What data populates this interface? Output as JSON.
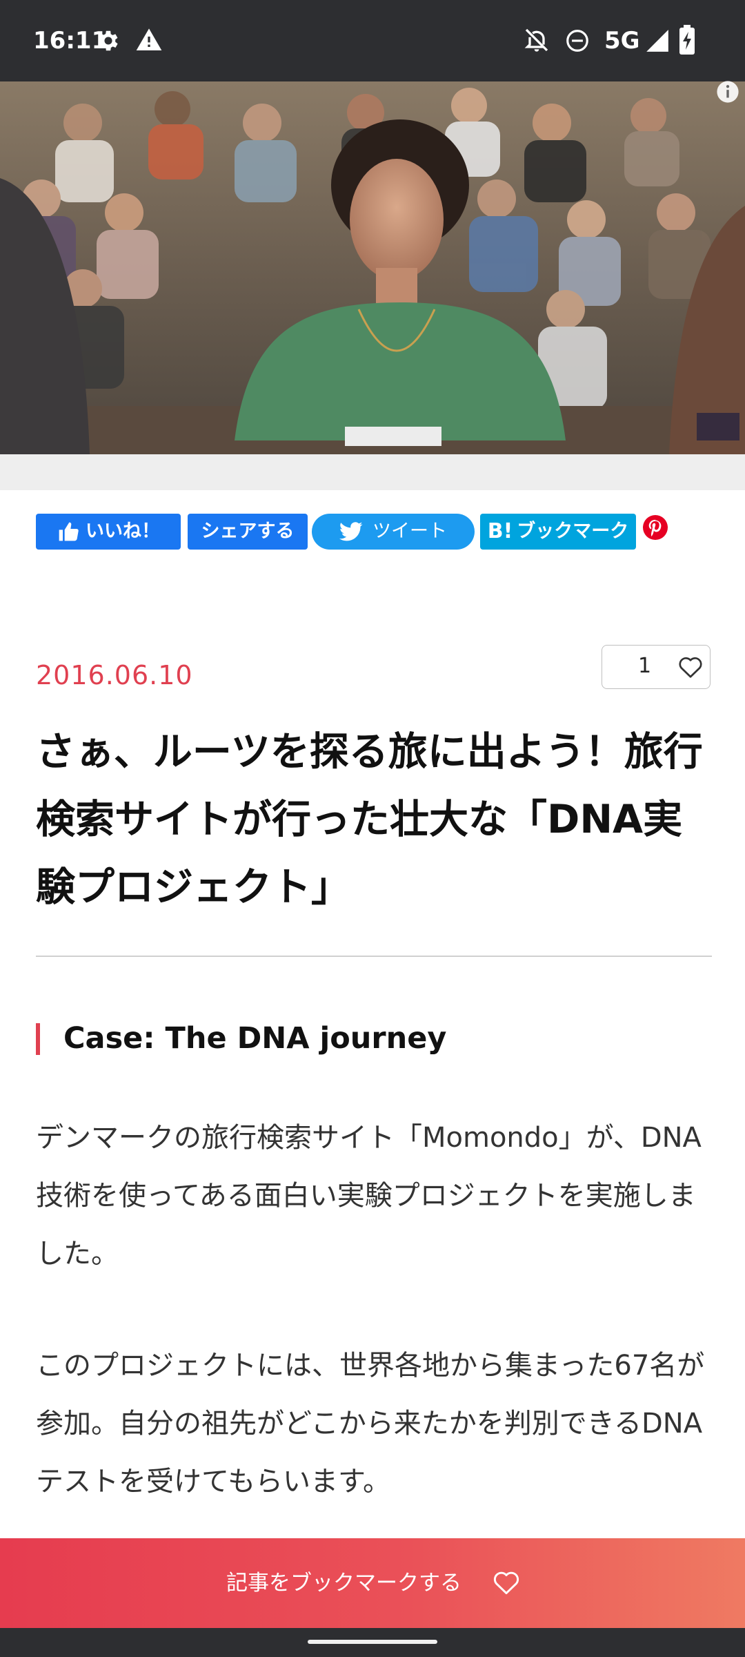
{
  "status_bar": {
    "time": "16:11",
    "network": "5G",
    "icons": [
      "gear-icon",
      "warning-icon",
      "bell-off-icon",
      "do-not-disturb-icon",
      "signal-icon",
      "battery-charging-icon"
    ]
  },
  "hero": {
    "image_alt": "woman in green shirt seated in front of audience",
    "icons": [
      "info-icon"
    ]
  },
  "share": {
    "like_label": "いいね！",
    "share_label": "シェアする",
    "tweet_label": "ツイート",
    "hatena_label": "ブックマーク",
    "hatena_mark": "B!",
    "icons": [
      "thumbs-up-icon",
      "twitter-bird-icon",
      "pinterest-icon"
    ]
  },
  "article": {
    "date": "2016.06.10",
    "like_count": "1",
    "title": "さぁ、ルーツを探る旅に出よう！旅行検索サイトが行った壮大な「DNA実験プロジェクト」",
    "section_heading": "Case: The DNA journey",
    "paragraphs": [
      "デンマークの旅行検索サイト「Momondo」が、DNA技術を使ってある面白い実験プロジェクトを実施しました。",
      "このプロジェクトには、世界各地から集まった67名が参加。自分の祖先がどこから来たかを判別できるDNAテストを受けてもらいます。"
    ]
  },
  "cta": {
    "label": "記事をブックマークする"
  },
  "colors": {
    "accent": "#e04050",
    "facebook": "#1a77f2",
    "twitter": "#1d9bf0",
    "hatena": "#00a4de",
    "pinterest": "#e60023"
  }
}
